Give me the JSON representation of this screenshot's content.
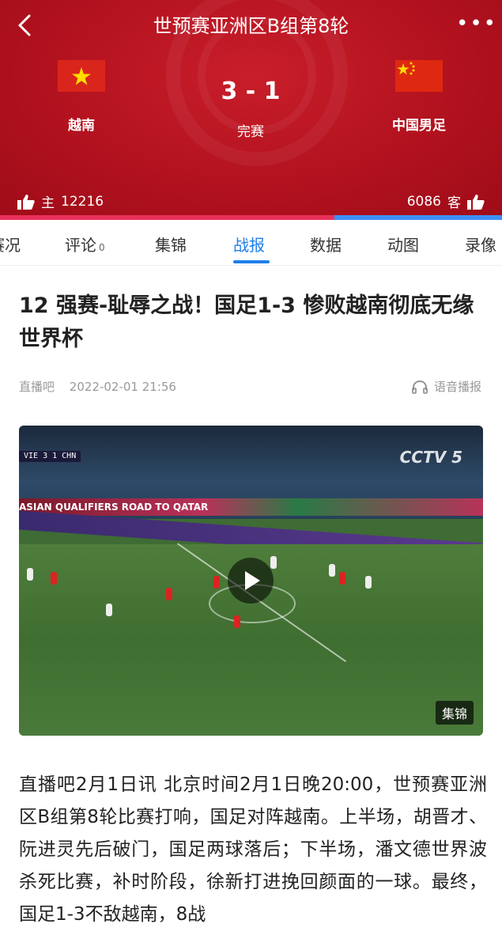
{
  "header": {
    "title": "世预赛亚洲区B组第8轮",
    "more_label": "•••",
    "home_team": "越南",
    "away_team": "中国男足",
    "score": "3 - 1",
    "status": "完赛",
    "home_likes_label": "主",
    "home_likes": "12216",
    "away_likes": "6086",
    "away_likes_label": "客",
    "home_support_fraction": 0.666,
    "colors": {
      "home_bar": "#e8305a",
      "away_bar": "#3d8ff5",
      "header_bg": "#b3121f"
    }
  },
  "tabs": [
    {
      "label": "赛况",
      "count": ""
    },
    {
      "label": "评论",
      "count": "0"
    },
    {
      "label": "集锦",
      "count": ""
    },
    {
      "label": "战报",
      "count": "",
      "active": true
    },
    {
      "label": "数据",
      "count": ""
    },
    {
      "label": "动图",
      "count": ""
    },
    {
      "label": "录像",
      "count": ""
    }
  ],
  "article": {
    "title": "12 强赛-耻辱之战！国足1-3 惨败越南彻底无缘世界杯",
    "source": "直播吧",
    "datetime": "2022-02-01 21:56",
    "voice_label": "语音播报",
    "video": {
      "badge": "集锦",
      "scoreboard": "VIE 3 1 CHN",
      "qualifier_text": "ASIAN QUALIFIERS ROAD TO QATAR",
      "broadcaster": "CCTV 5"
    },
    "body": "直播吧2月1日讯 北京时间2月1日晚20:00，世预赛亚洲区B组第8轮比赛打响，国足对阵越南。上半场，胡晋才、阮进灵先后破门，国足两球落后；下半场，潘文德世界波杀死比赛，补时阶段，徐新打进挽回颜面的一球。最终，国足1-3不敌越南，8战"
  },
  "icons": {
    "back": "chevron-left-icon",
    "more": "more-dots-icon",
    "like": "thumbs-up-icon",
    "headphones": "headphones-icon",
    "play": "play-icon"
  }
}
